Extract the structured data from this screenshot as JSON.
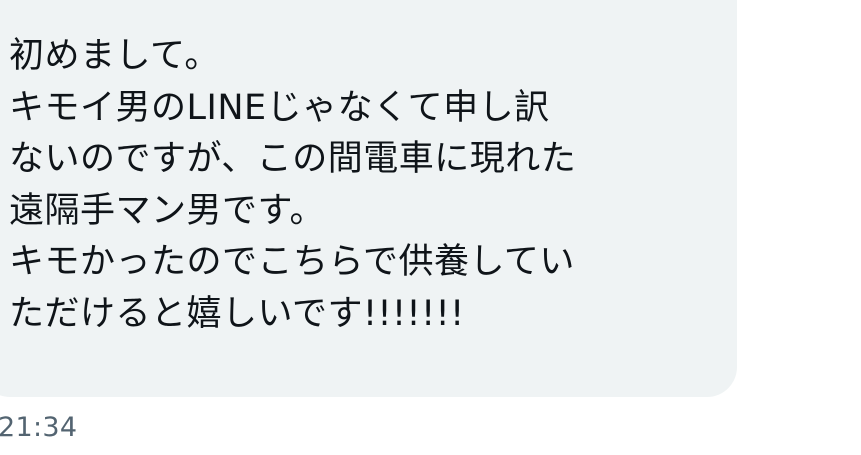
{
  "message": {
    "lines": [
      "初めまして。",
      "キモイ男のLINEじゃなくて申し訳",
      "ないのですが、この間電車に現れた",
      "遠隔手マン男です。",
      "キモかったのでこちらで供養してい",
      "ただけると嬉しいです!!!!!!!"
    ],
    "timestamp": "21:34"
  },
  "colors": {
    "bubble_background": "#eff3f4",
    "text": "#0f1419",
    "timestamp": "#536471"
  }
}
